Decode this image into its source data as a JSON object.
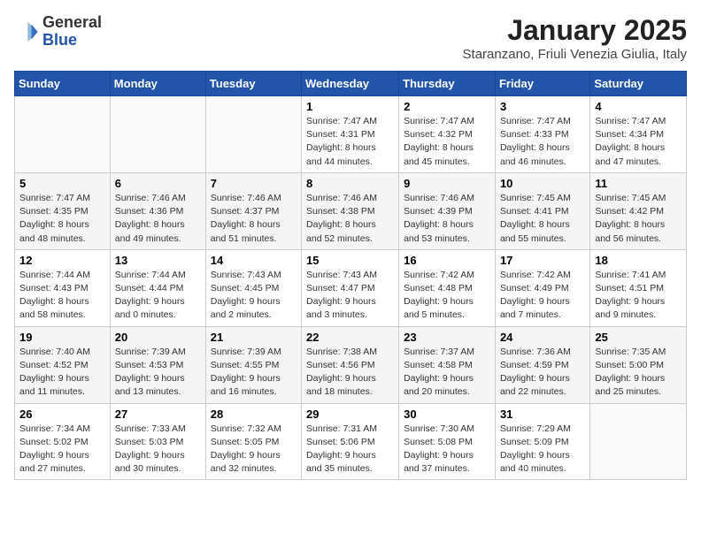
{
  "logo": {
    "general": "General",
    "blue": "Blue"
  },
  "title": "January 2025",
  "subtitle": "Staranzano, Friuli Venezia Giulia, Italy",
  "days_of_week": [
    "Sunday",
    "Monday",
    "Tuesday",
    "Wednesday",
    "Thursday",
    "Friday",
    "Saturday"
  ],
  "weeks": [
    [
      {
        "day": "",
        "info": ""
      },
      {
        "day": "",
        "info": ""
      },
      {
        "day": "",
        "info": ""
      },
      {
        "day": "1",
        "info": "Sunrise: 7:47 AM\nSunset: 4:31 PM\nDaylight: 8 hours\nand 44 minutes."
      },
      {
        "day": "2",
        "info": "Sunrise: 7:47 AM\nSunset: 4:32 PM\nDaylight: 8 hours\nand 45 minutes."
      },
      {
        "day": "3",
        "info": "Sunrise: 7:47 AM\nSunset: 4:33 PM\nDaylight: 8 hours\nand 46 minutes."
      },
      {
        "day": "4",
        "info": "Sunrise: 7:47 AM\nSunset: 4:34 PM\nDaylight: 8 hours\nand 47 minutes."
      }
    ],
    [
      {
        "day": "5",
        "info": "Sunrise: 7:47 AM\nSunset: 4:35 PM\nDaylight: 8 hours\nand 48 minutes."
      },
      {
        "day": "6",
        "info": "Sunrise: 7:46 AM\nSunset: 4:36 PM\nDaylight: 8 hours\nand 49 minutes."
      },
      {
        "day": "7",
        "info": "Sunrise: 7:46 AM\nSunset: 4:37 PM\nDaylight: 8 hours\nand 51 minutes."
      },
      {
        "day": "8",
        "info": "Sunrise: 7:46 AM\nSunset: 4:38 PM\nDaylight: 8 hours\nand 52 minutes."
      },
      {
        "day": "9",
        "info": "Sunrise: 7:46 AM\nSunset: 4:39 PM\nDaylight: 8 hours\nand 53 minutes."
      },
      {
        "day": "10",
        "info": "Sunrise: 7:45 AM\nSunset: 4:41 PM\nDaylight: 8 hours\nand 55 minutes."
      },
      {
        "day": "11",
        "info": "Sunrise: 7:45 AM\nSunset: 4:42 PM\nDaylight: 8 hours\nand 56 minutes."
      }
    ],
    [
      {
        "day": "12",
        "info": "Sunrise: 7:44 AM\nSunset: 4:43 PM\nDaylight: 8 hours\nand 58 minutes."
      },
      {
        "day": "13",
        "info": "Sunrise: 7:44 AM\nSunset: 4:44 PM\nDaylight: 9 hours\nand 0 minutes."
      },
      {
        "day": "14",
        "info": "Sunrise: 7:43 AM\nSunset: 4:45 PM\nDaylight: 9 hours\nand 2 minutes."
      },
      {
        "day": "15",
        "info": "Sunrise: 7:43 AM\nSunset: 4:47 PM\nDaylight: 9 hours\nand 3 minutes."
      },
      {
        "day": "16",
        "info": "Sunrise: 7:42 AM\nSunset: 4:48 PM\nDaylight: 9 hours\nand 5 minutes."
      },
      {
        "day": "17",
        "info": "Sunrise: 7:42 AM\nSunset: 4:49 PM\nDaylight: 9 hours\nand 7 minutes."
      },
      {
        "day": "18",
        "info": "Sunrise: 7:41 AM\nSunset: 4:51 PM\nDaylight: 9 hours\nand 9 minutes."
      }
    ],
    [
      {
        "day": "19",
        "info": "Sunrise: 7:40 AM\nSunset: 4:52 PM\nDaylight: 9 hours\nand 11 minutes."
      },
      {
        "day": "20",
        "info": "Sunrise: 7:39 AM\nSunset: 4:53 PM\nDaylight: 9 hours\nand 13 minutes."
      },
      {
        "day": "21",
        "info": "Sunrise: 7:39 AM\nSunset: 4:55 PM\nDaylight: 9 hours\nand 16 minutes."
      },
      {
        "day": "22",
        "info": "Sunrise: 7:38 AM\nSunset: 4:56 PM\nDaylight: 9 hours\nand 18 minutes."
      },
      {
        "day": "23",
        "info": "Sunrise: 7:37 AM\nSunset: 4:58 PM\nDaylight: 9 hours\nand 20 minutes."
      },
      {
        "day": "24",
        "info": "Sunrise: 7:36 AM\nSunset: 4:59 PM\nDaylight: 9 hours\nand 22 minutes."
      },
      {
        "day": "25",
        "info": "Sunrise: 7:35 AM\nSunset: 5:00 PM\nDaylight: 9 hours\nand 25 minutes."
      }
    ],
    [
      {
        "day": "26",
        "info": "Sunrise: 7:34 AM\nSunset: 5:02 PM\nDaylight: 9 hours\nand 27 minutes."
      },
      {
        "day": "27",
        "info": "Sunrise: 7:33 AM\nSunset: 5:03 PM\nDaylight: 9 hours\nand 30 minutes."
      },
      {
        "day": "28",
        "info": "Sunrise: 7:32 AM\nSunset: 5:05 PM\nDaylight: 9 hours\nand 32 minutes."
      },
      {
        "day": "29",
        "info": "Sunrise: 7:31 AM\nSunset: 5:06 PM\nDaylight: 9 hours\nand 35 minutes."
      },
      {
        "day": "30",
        "info": "Sunrise: 7:30 AM\nSunset: 5:08 PM\nDaylight: 9 hours\nand 37 minutes."
      },
      {
        "day": "31",
        "info": "Sunrise: 7:29 AM\nSunset: 5:09 PM\nDaylight: 9 hours\nand 40 minutes."
      },
      {
        "day": "",
        "info": ""
      }
    ]
  ]
}
